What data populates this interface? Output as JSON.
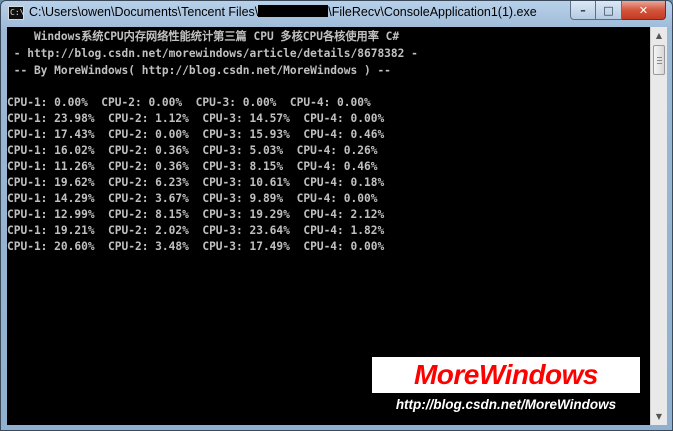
{
  "window": {
    "title_prefix": "C:\\Users\\owen\\Documents\\Tencent Files\\",
    "title_suffix": "\\FileRecv\\ConsoleApplication1(1).exe",
    "minimize_label": "–",
    "maximize_label": "□",
    "close_label": "✕"
  },
  "console": {
    "header": [
      "    Windows系统CPU内存网络性能统计第三篇 CPU 多核CPU各核使用率 C#",
      " - http://blog.csdn.net/morewindows/article/details/8678382 -",
      " -- By MoreWindows( http://blog.csdn.net/MoreWindows ) --"
    ],
    "readings": [
      "CPU-1: 0.00%  CPU-2: 0.00%  CPU-3: 0.00%  CPU-4: 0.00%",
      "CPU-1: 23.98%  CPU-2: 1.12%  CPU-3: 14.57%  CPU-4: 0.00%",
      "CPU-1: 17.43%  CPU-2: 0.00%  CPU-3: 15.93%  CPU-4: 0.46%",
      "CPU-1: 16.02%  CPU-2: 0.36%  CPU-3: 5.03%  CPU-4: 0.26%",
      "CPU-1: 11.26%  CPU-2: 0.36%  CPU-3: 8.15%  CPU-4: 0.46%",
      "CPU-1: 19.62%  CPU-2: 6.23%  CPU-3: 10.61%  CPU-4: 0.18%",
      "CPU-1: 14.29%  CPU-2: 3.67%  CPU-3: 9.89%  CPU-4: 0.00%",
      "CPU-1: 12.99%  CPU-2: 8.15%  CPU-3: 19.29%  CPU-4: 2.12%",
      "CPU-1: 19.21%  CPU-2: 2.02%  CPU-3: 23.64%  CPU-4: 1.82%",
      "CPU-1: 20.60%  CPU-2: 3.48%  CPU-3: 17.49%  CPU-4: 0.00%"
    ]
  },
  "watermark": {
    "title": "MoreWindows",
    "url": "http://blog.csdn.net/MoreWindows"
  },
  "icons": {
    "app": "console-app-icon",
    "scroll_up": "scroll-up-arrow-icon",
    "scroll_down": "scroll-down-arrow-icon"
  }
}
